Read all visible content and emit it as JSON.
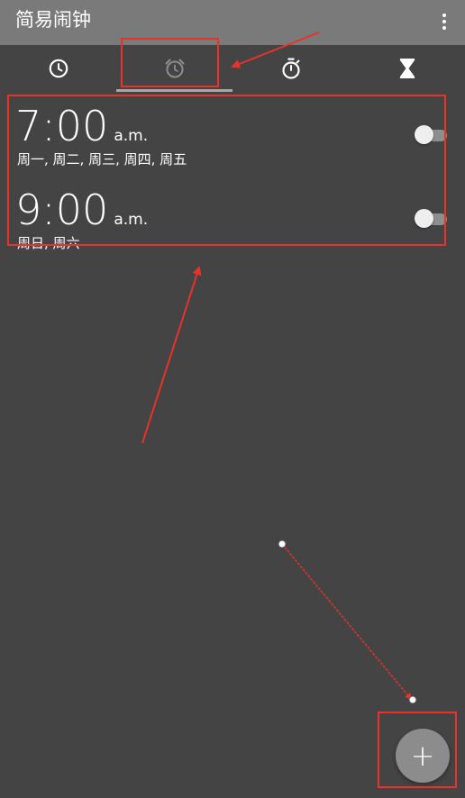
{
  "app": {
    "title": "简易闹钟"
  },
  "tabs": [
    {
      "name": "clock",
      "icon": "clock-icon",
      "active": false
    },
    {
      "name": "alarm",
      "icon": "alarm-clock-icon",
      "active": true
    },
    {
      "name": "stopwatch",
      "icon": "stopwatch-icon",
      "active": false
    },
    {
      "name": "timer",
      "icon": "hourglass-icon",
      "active": false
    }
  ],
  "alarms": [
    {
      "time": "7:00",
      "ampm": "a.m.",
      "days": "周一, 周二, 周三, 周四, 周五",
      "enabled": false
    },
    {
      "time": "9:00",
      "ampm": "a.m.",
      "days": "周日, 周六",
      "enabled": false
    }
  ],
  "fab": {
    "label": "+",
    "icon": "plus-icon"
  },
  "colors": {
    "background": "#444444",
    "appbar": "#7a7a7a",
    "annotation": "#e8322a",
    "fab": "#8c8c8c"
  }
}
